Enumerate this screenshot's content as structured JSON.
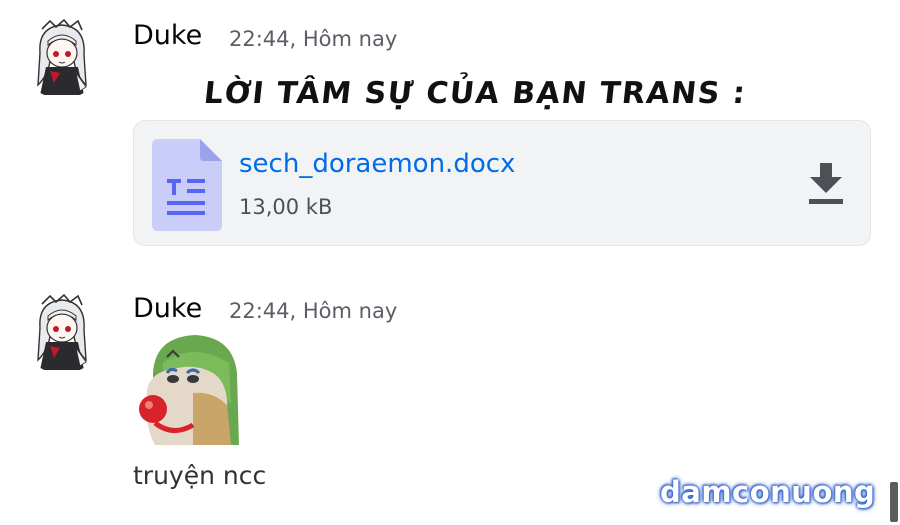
{
  "messages": [
    {
      "author": "Duke",
      "timestamp": "22:44, Hôm nay",
      "caption": "LỜI TÂM SỰ CỦA BẠN TRANS :",
      "attachment": {
        "file_name": "sech_doraemon.docx",
        "file_size": "13,00 kB",
        "icon": "document-icon",
        "action_icon": "download-icon"
      }
    },
    {
      "author": "Duke",
      "timestamp": "22:44, Hôm nay",
      "emoji": "clown-dog-emoji",
      "text": "truyện ncc"
    }
  ],
  "watermark": "damconuong",
  "colors": {
    "link": "#006ce7",
    "timestamp": "#5c5e66",
    "attachment_bg": "#f2f3f5",
    "doc_icon": "#c9cdf7"
  }
}
